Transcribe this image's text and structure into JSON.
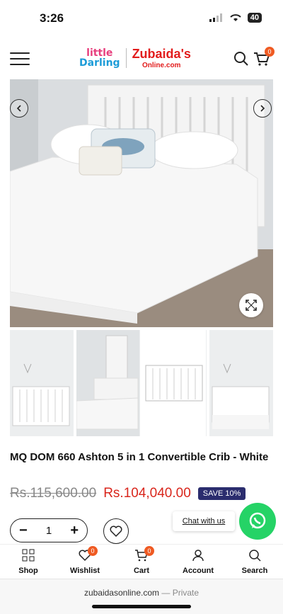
{
  "status": {
    "time": "3:26",
    "battery": "40"
  },
  "header": {
    "logo_left_line1": "little",
    "logo_left_line2": "Darling",
    "logo_right_line1": "Zubaida's",
    "logo_right_line2": "Online.com",
    "cart_count": "0"
  },
  "product": {
    "title": "MQ DOM 660 Ashton 5 in 1 Convertible Crib - White",
    "old_price": "Rs.115,600.00",
    "new_price": "Rs.104,040.00",
    "save_badge": "SAVE 10%",
    "quantity": "1"
  },
  "chat": {
    "label": "Chat with us"
  },
  "tabs": [
    {
      "label": "Shop",
      "icon": "grid-icon"
    },
    {
      "label": "Wishlist",
      "icon": "heart-icon",
      "badge": "0"
    },
    {
      "label": "Cart",
      "icon": "cart-icon",
      "badge": "0"
    },
    {
      "label": "Account",
      "icon": "user-icon"
    },
    {
      "label": "Search",
      "icon": "search-icon"
    }
  ],
  "browser": {
    "domain": "zubaidasonline.com",
    "mode": "— Private"
  },
  "colors": {
    "accent": "#ef5a22",
    "price": "#d9261c",
    "badge": "#2b2d6e",
    "whatsapp": "#25d366"
  }
}
